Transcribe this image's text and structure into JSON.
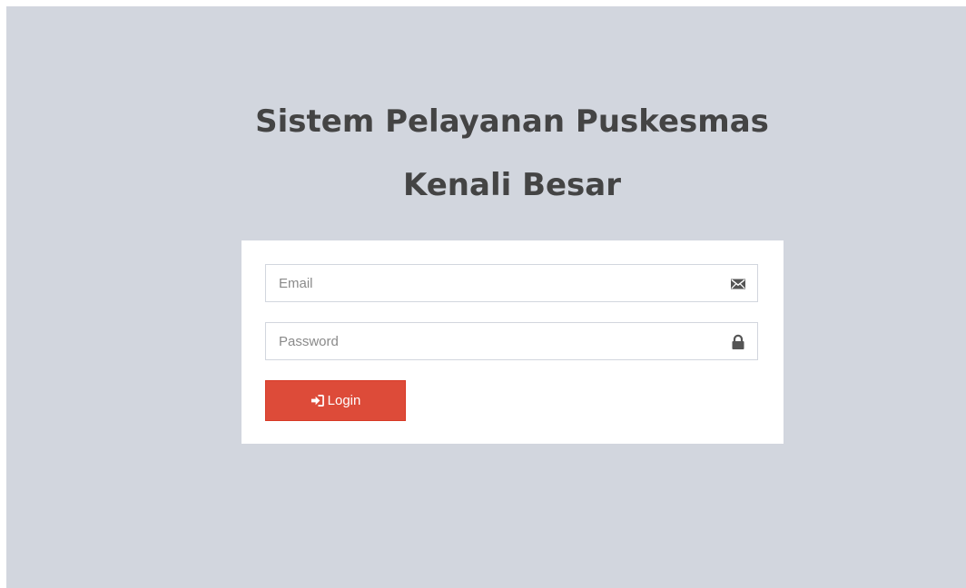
{
  "header": {
    "title_line1": "Sistem Pelayanan Puskesmas",
    "title_line2": "Kenali Besar"
  },
  "form": {
    "email": {
      "placeholder": "Email",
      "value": "",
      "icon": "envelope-icon"
    },
    "password": {
      "placeholder": "Password",
      "value": "",
      "icon": "lock-icon"
    },
    "login_button": {
      "label": "Login",
      "icon": "sign-in-icon"
    }
  },
  "colors": {
    "page_background": "#d2d6de",
    "box_background": "#ffffff",
    "title": "#444444",
    "button": "#dd4b39",
    "button_text": "#ffffff",
    "input_border": "#d2d6de"
  }
}
